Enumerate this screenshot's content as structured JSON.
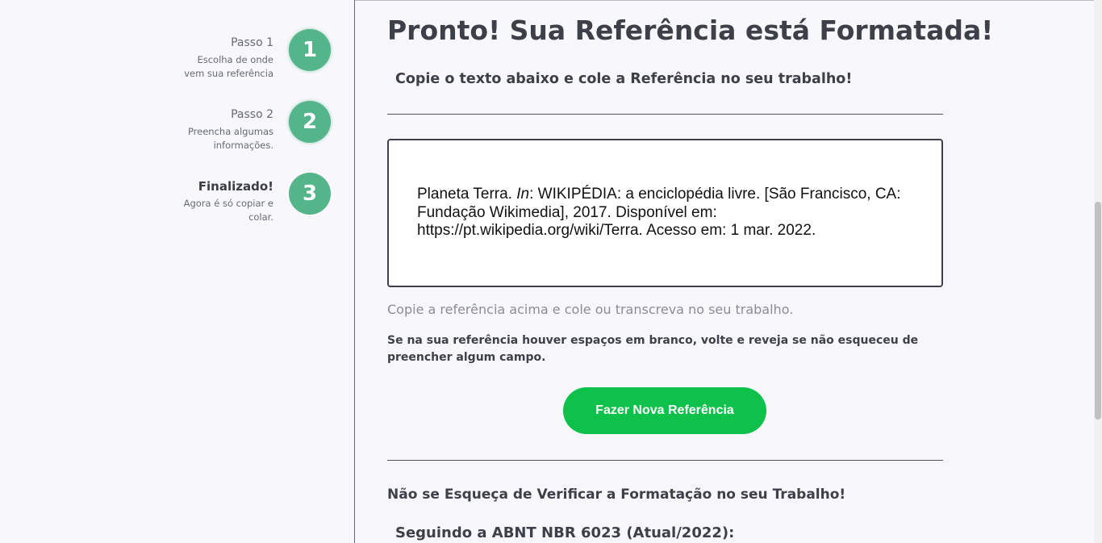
{
  "steps": [
    {
      "title": "Passo 1",
      "desc_line1": "Escolha de onde",
      "desc_line2": "vem sua referência",
      "number": "1"
    },
    {
      "title": "Passo 2",
      "desc_line1": "Preencha algumas",
      "desc_line2": "informações.",
      "number": "2"
    },
    {
      "title": "Finalizado!",
      "desc_line1": "Agora é só copiar e",
      "desc_line2": "colar.",
      "number": "3"
    }
  ],
  "main": {
    "heading": "Pronto! Sua Referência está Formatada!",
    "subheading": "Copie o texto abaixo e cole a Referência no seu trabalho!",
    "reference": {
      "part1": "Planeta Terra. ",
      "italic": "In",
      "part2": ": WIKIPÉDIA: a enciclopédia livre. [São Francisco, CA: Fundação Wikimedia], 2017. Disponível em: https://pt.wikipedia.org/wiki/Terra. Acesso em: 1 mar. 2022."
    },
    "hint": "Copie a referência acima e cole ou transcreva no seu trabalho.",
    "warning": "Se na sua referência houver espaços em branco, volte e reveja se não esqueceu de preencher algum campo.",
    "button_label": "Fazer Nova Referência",
    "check_heading": "Não se Esqueça de Verificar a Formatação no seu Trabalho!",
    "abnt_heading": "Seguindo a ABNT NBR 6023 (Atual/2022):"
  },
  "colors": {
    "step_circle": "#55b58a",
    "button": "#0dc14a",
    "background": "#f8f8fc"
  }
}
